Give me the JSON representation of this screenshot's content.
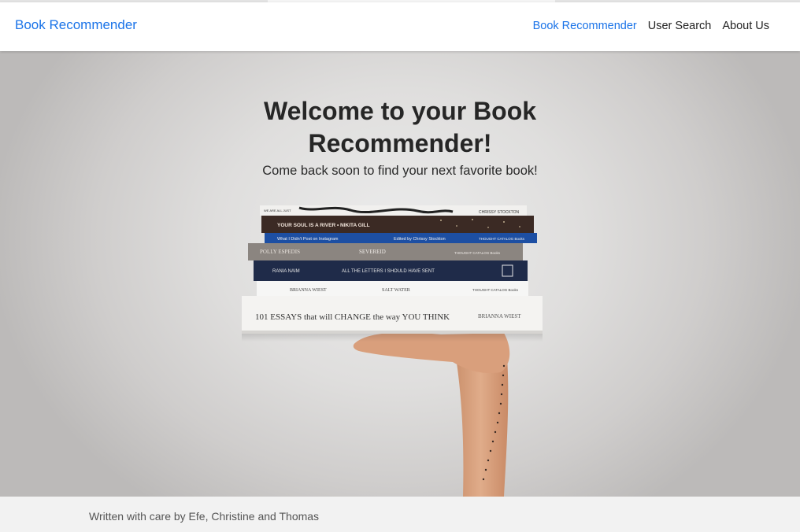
{
  "nav": {
    "brand": "Book Recommender",
    "links": [
      {
        "label": "Book Recommender",
        "active": true
      },
      {
        "label": "User Search",
        "active": false
      },
      {
        "label": "About Us",
        "active": false
      }
    ]
  },
  "hero": {
    "title_line1": "Welcome to your Book",
    "title_line2": "Recommender!",
    "subtitle": "Come back soon to find your next favorite book!",
    "books": [
      {
        "spine": "WE ARE ALL JUST A COLLECTION OF WORDS · CHRISSY STOCKTON"
      },
      {
        "spine": "YOUR SOUL IS A RIVER · NIKITA GILL"
      },
      {
        "spine": "What I Didn't Post on Instagram · Edited by Chrissy Stockton · THOUGHT CATALOG Books"
      },
      {
        "spine": "SEVEREID · THOUGHT CATALOG Books"
      },
      {
        "spine": "RANIA NAIM · ALL THE LETTERS I SHOULD HAVE SENT"
      },
      {
        "spine": "BRIANNA WIEST · SALT WATER · THOUGHT CATALOG Books"
      },
      {
        "spine": "101 ESSAYS that will CHANGE the way YOU THINK · BRIANNA WIEST"
      }
    ]
  },
  "footer": {
    "text": "Written with care by Efe, Christine and Thomas"
  },
  "colors": {
    "accent": "#1a73e8",
    "text": "#222222",
    "footer_bg": "#f2f2f2"
  }
}
